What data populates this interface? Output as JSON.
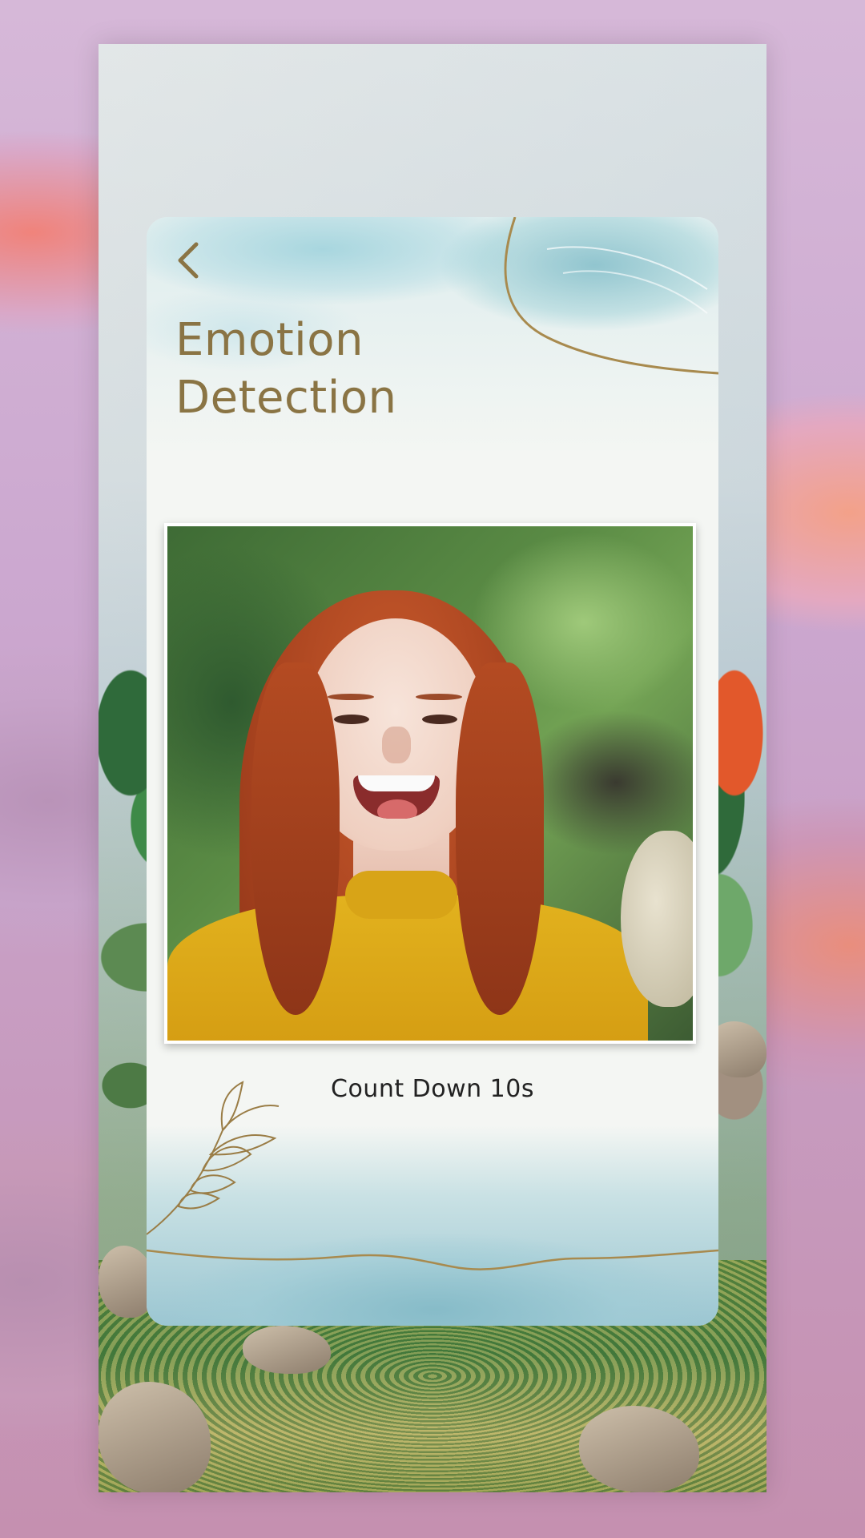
{
  "screen": {
    "title_line1": "Emotion",
    "title_line2": "Detection",
    "countdown_label": "Count Down 10s"
  },
  "colors": {
    "title_gold": "#8a7444",
    "accent_teal": "#8cbecc",
    "card_bg": "#f4f6f3"
  },
  "icons": {
    "back": "chevron-left-icon",
    "decoration": "leaf-branch-icon"
  }
}
